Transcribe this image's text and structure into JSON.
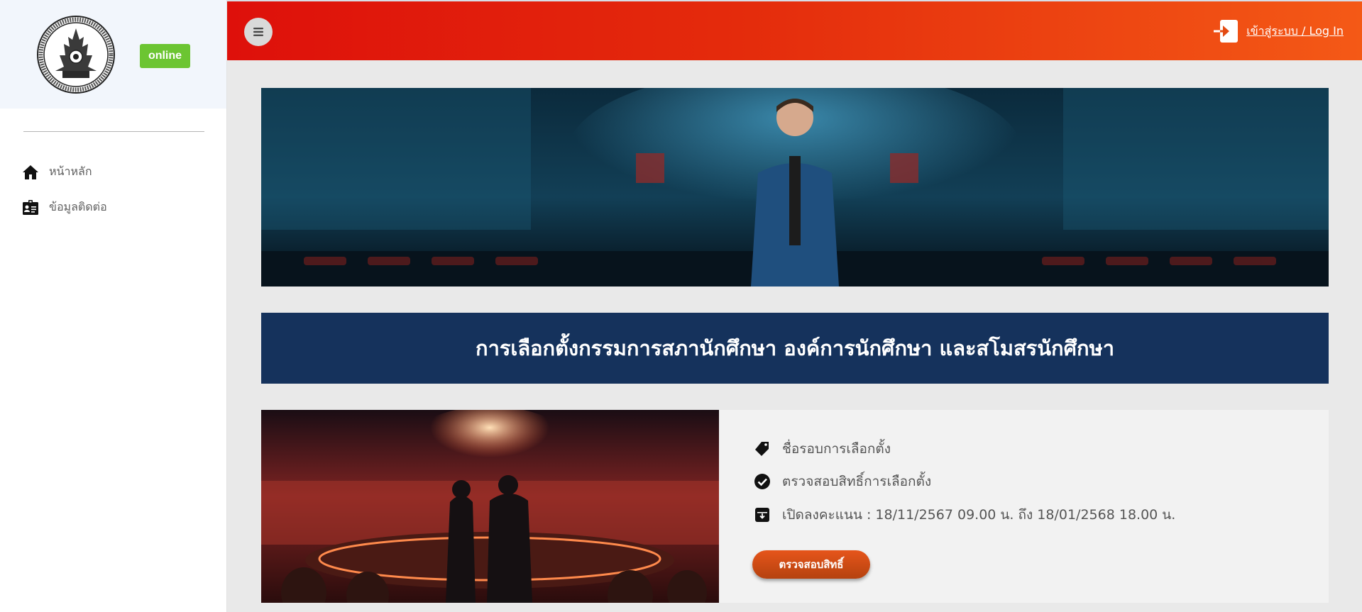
{
  "sidebar": {
    "status_badge": "online",
    "items": [
      {
        "label": "หน้าหลัก",
        "icon": "home-icon"
      },
      {
        "label": "ข้อมูลติดต่อ",
        "icon": "contact-card-icon"
      }
    ]
  },
  "header": {
    "menu_icon": "hamburger-menu-icon",
    "login_label": "เข้าสู่ระบบ / Log In",
    "login_icon": "sign-in-icon"
  },
  "main": {
    "title": "การเลือกตั้งกรรมการสภานักศึกษา องค์การนักศึกษา และสโมสรนักศึกษา",
    "election": {
      "round_name_label": "ชื่อรอบการเลือกตั้ง",
      "check_rights_label": "ตรวจสอบสิทธิ์การเลือกตั้ง",
      "voting_period": "เปิดลงคะแนน : 18/11/2567 09.00 น. ถึง 18/01/2568 18.00 น.",
      "button_label": "ตรวจสอบสิทธิ์"
    }
  },
  "colors": {
    "header_start": "#de100b",
    "header_end": "#f45916",
    "title_bg": "#15325c",
    "online_badge": "#6cc532",
    "button": "#d9501a"
  }
}
